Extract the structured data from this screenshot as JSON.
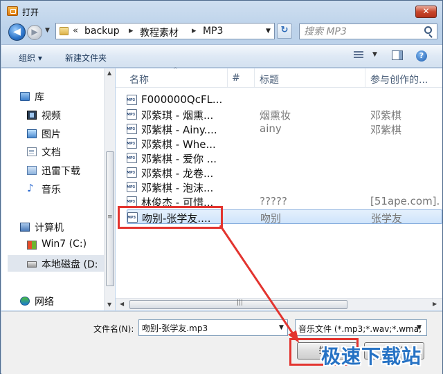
{
  "window": {
    "title": "打开",
    "close_glyph": "✕"
  },
  "nav": {
    "back_glyph": "◀",
    "forward_glyph": "▶",
    "recent_glyph": "▼",
    "refresh_glyph": "↻"
  },
  "address": {
    "overflow": "«",
    "segments": [
      "backup",
      "教程素材",
      "MP3"
    ],
    "separator": "▸",
    "drop_glyph": "▼"
  },
  "search": {
    "placeholder": "搜索 MP3"
  },
  "toolbar": {
    "organize": "组织 ▾",
    "new_folder": "新建文件夹",
    "view_drop": "▼",
    "help": "?"
  },
  "sidebar": {
    "items": [
      {
        "label": "库",
        "icon": "library-icon"
      },
      {
        "label": "视频",
        "icon": "video-icon"
      },
      {
        "label": "图片",
        "icon": "pictures-icon"
      },
      {
        "label": "文档",
        "icon": "documents-icon"
      },
      {
        "label": "迅雷下载",
        "icon": "download-folder-icon"
      },
      {
        "label": "音乐",
        "icon": "music-icon"
      },
      {
        "label": "计算机",
        "icon": "computer-icon"
      },
      {
        "label": "Win7 (C:)",
        "icon": "system-drive-icon"
      },
      {
        "label": "本地磁盘 (D:",
        "icon": "local-disk-icon"
      },
      {
        "label": "网络",
        "icon": "network-icon"
      }
    ],
    "scroll_grip": "≡",
    "arrow_up": "▲",
    "arrow_down": "▼"
  },
  "columns": {
    "name": "名称",
    "number": "#",
    "title": "标题",
    "artist": "参与创作的...",
    "sort_glyph": "^"
  },
  "files": [
    {
      "name": "F000000QcFL...",
      "title": "",
      "artist": ""
    },
    {
      "name": "邓紫琪 - 烟熏...",
      "title": "烟熏妆",
      "artist": "邓紫棋"
    },
    {
      "name": "邓紫棋 - Ainy....",
      "title": "ainy",
      "artist": "邓紫棋"
    },
    {
      "name": "邓紫棋 - Whe...",
      "title": "",
      "artist": ""
    },
    {
      "name": "邓紫棋 - 爱你 ...",
      "title": "",
      "artist": ""
    },
    {
      "name": "邓紫棋 - 龙卷...",
      "title": "",
      "artist": ""
    },
    {
      "name": "邓紫棋 - 泡沫...",
      "title": "",
      "artist": ""
    },
    {
      "name": "林俊杰 - 可惜...",
      "title": "?????",
      "artist": "[51ape.com]."
    },
    {
      "name": "吻别-张学友....",
      "title": "吻别",
      "artist": "张学友"
    }
  ],
  "hscroll": {
    "left": "◀",
    "right": "▶",
    "grip": "|||"
  },
  "filename": {
    "label": "文件名(N):",
    "value": "吻别-张学友.mp3",
    "drop_glyph": "▼"
  },
  "filter": {
    "value": "音乐文件 (*.mp3;*.wav;*.wma;",
    "drop_glyph": "▼"
  },
  "buttons": {
    "open": "打开",
    "cancel": "取消"
  },
  "watermark": {
    "text": "极速下载站"
  },
  "colors": {
    "annotation": "#e3342f",
    "selection": "#cfe4fb",
    "watermark": "#2672c4"
  }
}
